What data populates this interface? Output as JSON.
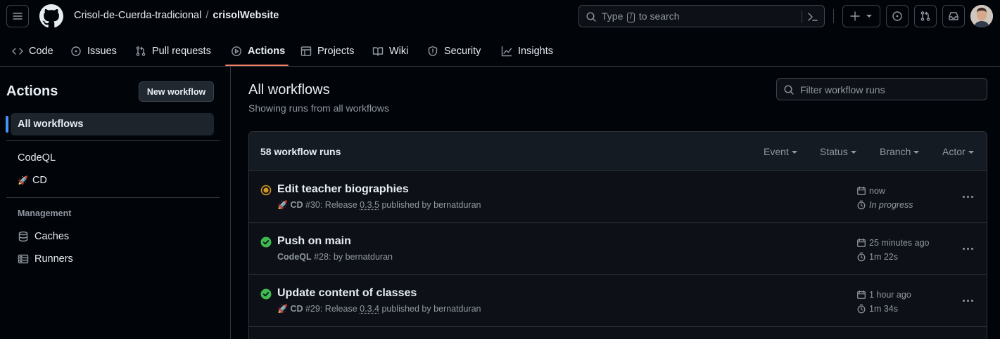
{
  "header": {
    "owner": "Crisol-de-Cuerda-tradicional",
    "separator": "/",
    "repo": "crisolWebsite",
    "search_prefix": "Type",
    "search_key": "/",
    "search_suffix": "to search"
  },
  "tabs": [
    {
      "label": "Code",
      "icon": "code-icon"
    },
    {
      "label": "Issues",
      "icon": "issue-icon"
    },
    {
      "label": "Pull requests",
      "icon": "pull-request-icon"
    },
    {
      "label": "Actions",
      "icon": "play-icon",
      "active": true
    },
    {
      "label": "Projects",
      "icon": "table-icon"
    },
    {
      "label": "Wiki",
      "icon": "book-icon"
    },
    {
      "label": "Security",
      "icon": "shield-icon"
    },
    {
      "label": "Insights",
      "icon": "graph-icon"
    }
  ],
  "sidebar": {
    "title": "Actions",
    "new_workflow": "New workflow",
    "all_workflows": "All workflows",
    "workflows": [
      {
        "label": "CodeQL"
      },
      {
        "label": "CD",
        "emoji": "🚀"
      }
    ],
    "management_heading": "Management",
    "management": [
      {
        "label": "Caches",
        "icon": "database-icon"
      },
      {
        "label": "Runners",
        "icon": "server-icon"
      }
    ]
  },
  "main": {
    "title": "All workflows",
    "subtitle": "Showing runs from all workflows",
    "filter_placeholder": "Filter workflow runs",
    "run_count": "58 workflow runs",
    "filters": [
      "Event",
      "Status",
      "Branch",
      "Actor"
    ]
  },
  "runs": [
    {
      "title": "Edit teacher biographies",
      "status": "in-progress",
      "emoji": "🚀",
      "workflow": "CD",
      "number": "#30: Release",
      "version": "0.3.5",
      "by": "published by bernatduran",
      "time": "now",
      "duration": "In progress"
    },
    {
      "title": "Push on main",
      "status": "success",
      "workflow": "CodeQL",
      "number": "#28: by bernatduran",
      "time": "25 minutes ago",
      "duration": "1m 22s"
    },
    {
      "title": "Update content of classes",
      "status": "success",
      "emoji": "🚀",
      "workflow": "CD",
      "number": "#29: Release",
      "version": "0.3.4",
      "by": "published by bernatduran",
      "time": "1 hour ago",
      "duration": "1m 34s"
    }
  ],
  "colors": {
    "accent_underline": "#f78166",
    "selected_indicator": "#4493f8",
    "success": "#3fb950",
    "in_progress": "#d29922"
  }
}
